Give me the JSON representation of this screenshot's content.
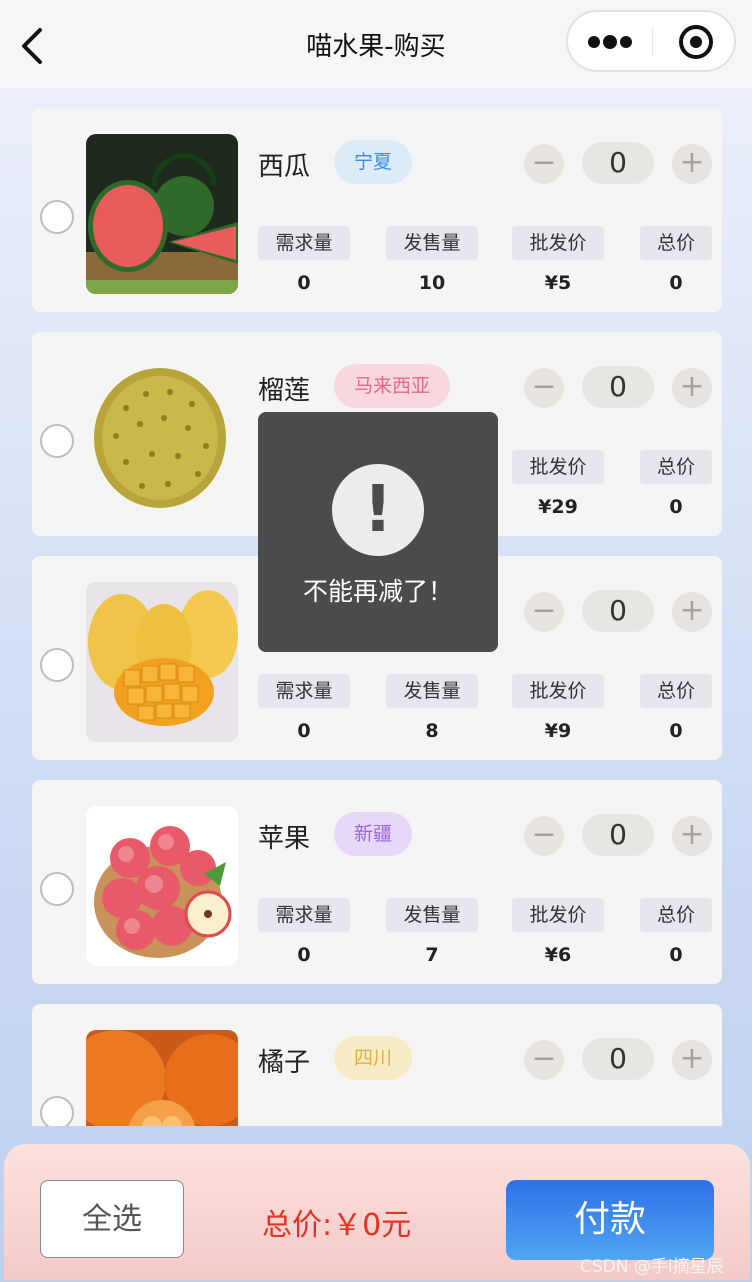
{
  "nav": {
    "title": "喵水果-购买"
  },
  "column_labels": [
    "需求量",
    "发售量",
    "批发价",
    "总价"
  ],
  "items": [
    {
      "name": "西瓜",
      "origin": "宁夏",
      "tag_color": "#3a8ee0",
      "tag_bg": "#dcebf6",
      "qty": "0",
      "demand": "0",
      "sales": "10",
      "price": "¥5",
      "total": "0",
      "image": "watermelon"
    },
    {
      "name": "榴莲",
      "origin": "马来西亚",
      "tag_color": "#e86a80",
      "tag_bg": "#f8d7de",
      "qty": "0",
      "demand": "",
      "sales": "",
      "price": "¥29",
      "total": "0",
      "image": "durian"
    },
    {
      "name": "",
      "origin": "",
      "tag_color": "",
      "tag_bg": "",
      "qty": "0",
      "demand": "0",
      "sales": "8",
      "price": "¥9",
      "total": "0",
      "image": "mango"
    },
    {
      "name": "苹果",
      "origin": "新疆",
      "tag_color": "#9a63e0",
      "tag_bg": "#e8d8f8",
      "qty": "0",
      "demand": "0",
      "sales": "7",
      "price": "¥6",
      "total": "0",
      "image": "apple"
    },
    {
      "name": "橘子",
      "origin": "四川",
      "tag_color": "#e0b040",
      "tag_bg": "#f8ecc6",
      "qty": "0",
      "demand": "",
      "sales": "",
      "price": "",
      "total": "",
      "image": "orange"
    }
  ],
  "stepper": {
    "minus": "−",
    "plus": "+"
  },
  "toast": {
    "icon": "!",
    "text": "不能再减了！"
  },
  "footer": {
    "select_all": "全选",
    "total": "总价:￥0元",
    "pay": "付款"
  },
  "watermark": "CSDN @手i摘星辰"
}
